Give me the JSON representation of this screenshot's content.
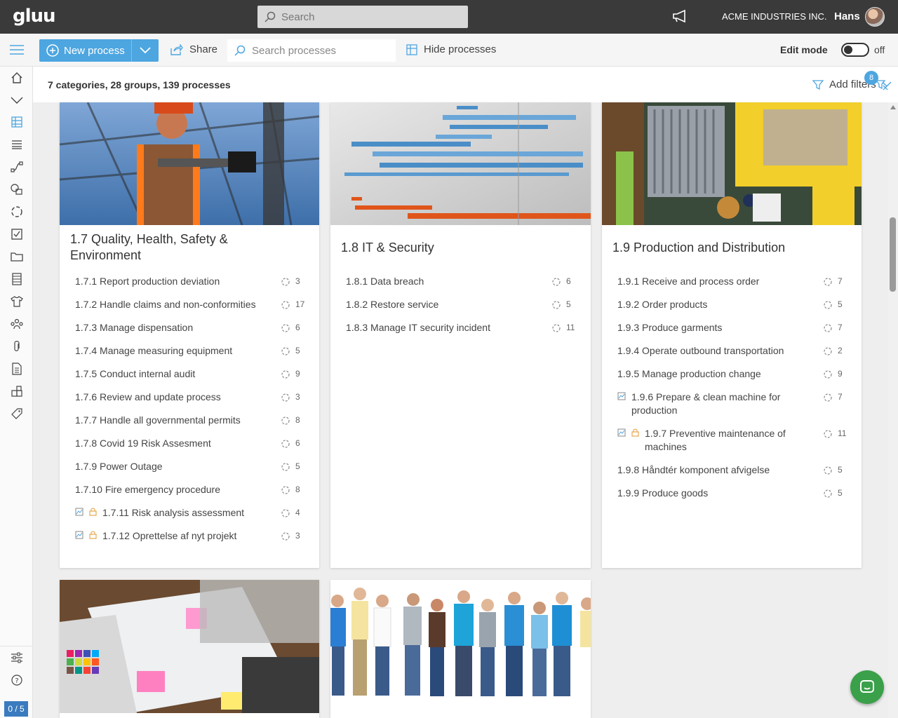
{
  "topbar": {
    "logo": "gluu",
    "search_placeholder": "Search",
    "company": "ACME INDUSTRIES INC.",
    "user": "Hans"
  },
  "toolbar": {
    "new_process": "New process",
    "share": "Share",
    "search_processes_placeholder": "Search processes",
    "hide_processes": "Hide processes",
    "edit_mode_label": "Edit mode",
    "edit_mode_state": "off"
  },
  "summary": "7 categories, 28 groups, 139 processes",
  "filters": {
    "label": "Add filters",
    "badge": "8"
  },
  "rail": {
    "items": [
      "home-icon",
      "chevron-down-icon",
      "grid-icon",
      "list-icon",
      "flow-icon",
      "shapes-icon",
      "cycle-icon",
      "checkbox-icon",
      "folder-icon",
      "server-icon",
      "shirt-icon",
      "org-icon",
      "paperclip-icon",
      "document-icon",
      "widgets-icon",
      "tag-icon"
    ],
    "bottom": [
      "sliders-icon",
      "help-icon"
    ],
    "counter": "0 / 5"
  },
  "colors": {
    "accent": "#4da6e0",
    "topbar": "#3a3a3a",
    "chat": "#3aa04a",
    "lock": "#e8a040"
  },
  "cards": [
    {
      "title_line1": "1.7 Quality, Health, Safety &",
      "title_line2": "Environment",
      "processes": [
        {
          "label": "1.7.1 Report production deviation",
          "count": "3"
        },
        {
          "label": "1.7.2 Handle claims and non-conformities",
          "count": "17"
        },
        {
          "label": "1.7.3 Manage dispensation",
          "count": "6"
        },
        {
          "label": "1.7.4 Manage measuring equipment",
          "count": "5"
        },
        {
          "label": "1.7.5 Conduct internal audit",
          "count": "9"
        },
        {
          "label": "1.7.6 Review and update process",
          "count": "3"
        },
        {
          "label": "1.7.7 Handle all governmental permits",
          "count": "8"
        },
        {
          "label": "1.7.8 Covid 19 Risk Assesment",
          "count": "6"
        },
        {
          "label": "1.7.9 Power Outage",
          "count": "5"
        },
        {
          "label": "1.7.10 Fire emergency procedure",
          "count": "8"
        },
        {
          "label": "1.7.11 Risk analysis assessment",
          "count": "4"
        },
        {
          "label": "1.7.12 Oprettelse af nyt projekt",
          "count": "3"
        }
      ]
    },
    {
      "title_line1": "1.8 IT & Security",
      "processes": [
        {
          "label": "1.8.1 Data breach",
          "count": "6"
        },
        {
          "label": "1.8.2 Restore service",
          "count": "5"
        },
        {
          "label": "1.8.3 Manage IT security incident",
          "count": "11"
        }
      ]
    },
    {
      "title_line1": "1.9 Production and Distribution",
      "processes": [
        {
          "label": "1.9.1 Receive and process order",
          "count": "7"
        },
        {
          "label": "1.9.2 Order products",
          "count": "5"
        },
        {
          "label": "1.9.3 Produce garments",
          "count": "7"
        },
        {
          "label": "1.9.4 Operate outbound transportation",
          "count": "2"
        },
        {
          "label": "1.9.5 Manage production change",
          "count": "9"
        },
        {
          "label_line1": "1.9.6 Prepare & clean machine for",
          "label_line2": "production",
          "count": "7"
        },
        {
          "label_line1": "1.9.7 Preventive maintenance of",
          "label_line2": "machines",
          "count": "11"
        },
        {
          "label": "1.9.8 Håndtér komponent afvigelse",
          "count": "5"
        },
        {
          "label": "1.9.9 Produce goods",
          "count": "5"
        }
      ]
    }
  ]
}
